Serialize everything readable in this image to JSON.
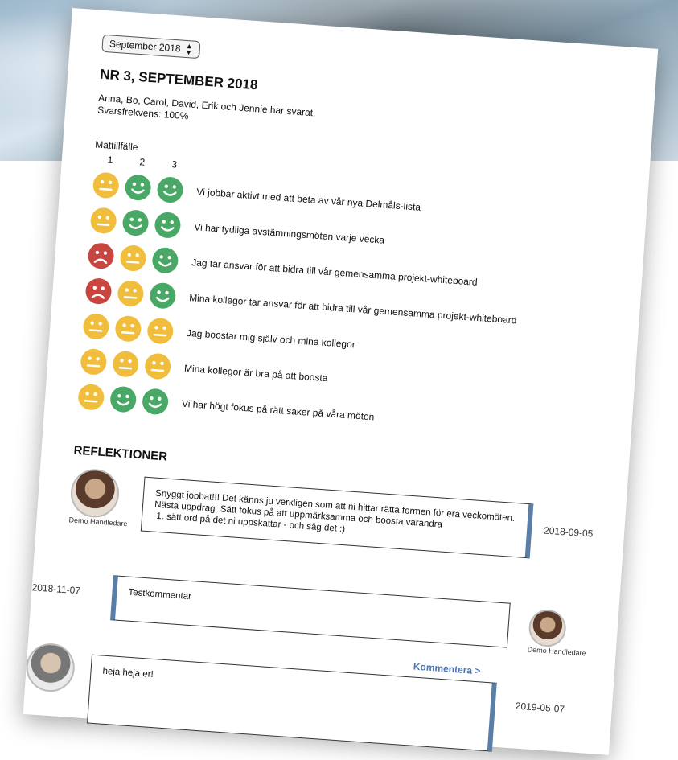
{
  "selector": {
    "value": "September 2018"
  },
  "header": {
    "title": "NR 3, SEPTEMBER 2018",
    "responders": "Anna, Bo, Carol, David, Erik och Jennie har svarat.",
    "response_rate": "Svarsfrekvens: 100%"
  },
  "measure": {
    "label": "Mättillfälle",
    "columns": [
      "1",
      "2",
      "3"
    ]
  },
  "colors": {
    "green": "#4aa866",
    "yellow": "#f0be3c",
    "red": "#c9453f",
    "accent": "#5b7ea8",
    "link": "#4a77b4"
  },
  "rows": [
    {
      "text": "Vi jobbar aktivt med att beta av vår nya Delmåls-lista",
      "faces": [
        "neutral",
        "happy",
        "happy"
      ]
    },
    {
      "text": "Vi har tydliga avstämningsmöten varje vecka",
      "faces": [
        "neutral",
        "happy",
        "happy"
      ]
    },
    {
      "text": "Jag tar ansvar för att bidra till vår gemensamma projekt-whiteboard",
      "faces": [
        "sad",
        "neutral",
        "happy"
      ]
    },
    {
      "text": "Mina kollegor tar ansvar för att bidra till vår gemensamma projekt-whiteboard",
      "faces": [
        "sad",
        "neutral",
        "happy"
      ]
    },
    {
      "text": "Jag boostar mig själv och mina kollegor",
      "faces": [
        "neutral",
        "neutral",
        "neutral"
      ]
    },
    {
      "text": "Mina kollegor är bra på att boosta",
      "faces": [
        "neutral",
        "neutral",
        "neutral"
      ]
    },
    {
      "text": "Vi har högt fokus på rätt saker på våra möten",
      "faces": [
        "neutral",
        "happy",
        "happy"
      ]
    }
  ],
  "reflections": {
    "heading": "REFLEKTIONER",
    "items": [
      {
        "author": "Demo Handledare",
        "date": "2018-09-05",
        "line1": "Snyggt jobbat!!! Det känns ju verkligen som att ni hittar rätta formen för era veckomöten.",
        "line2": "Nästa uppdrag: Sätt fokus på att uppmärksamma och boosta varandra",
        "list_item": "sätt ord på det ni uppskattar - och säg det :)"
      },
      {
        "author": "Demo Handledare",
        "date": "2018-11-07",
        "text": "Testkommentar"
      },
      {
        "date": "2019-05-07",
        "text": "heja heja er!",
        "comment_link": "Kommentera >"
      }
    ]
  }
}
